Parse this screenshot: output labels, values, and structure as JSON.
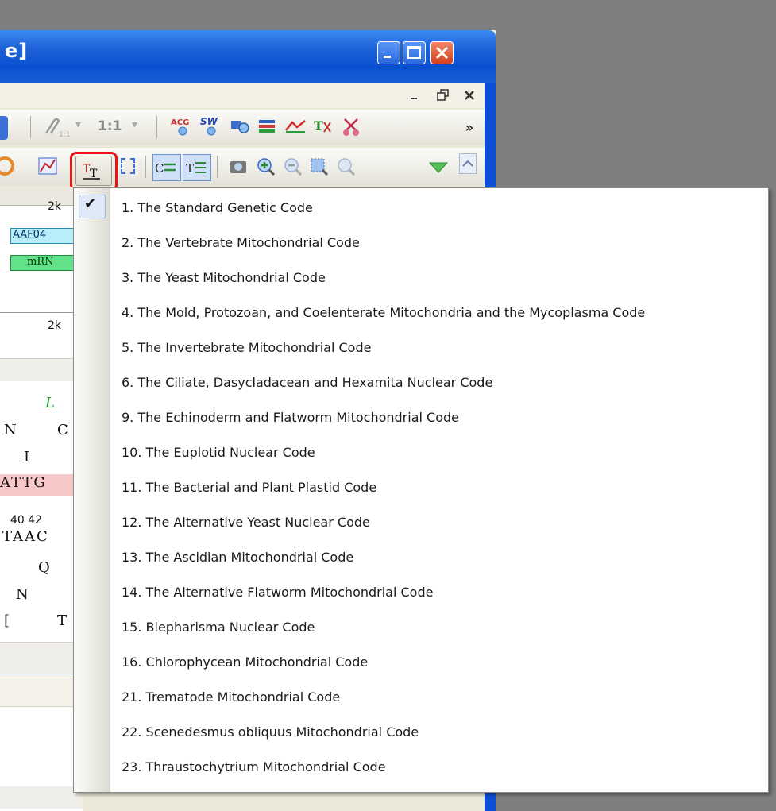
{
  "window": {
    "title_fragment": "e]",
    "caption_buttons": [
      "minimize-icon",
      "maximize-icon",
      "close-icon"
    ],
    "mdi_buttons": [
      "minimize-icon",
      "restore-icon",
      "close-icon"
    ],
    "accent_color": "#0c4fd6"
  },
  "toolbar1": {
    "zoom_label": "1:1",
    "overflow_label": "»",
    "icons": [
      "paperclip-icon",
      "acg-search-icon",
      "sw-search-icon",
      "find-icon",
      "list-icon",
      "map-icon",
      "tool-icon",
      "scissors-icon"
    ]
  },
  "toolbar2": {
    "icons": [
      "circle-map-icon",
      "chart-icon",
      "translate-icon",
      "select-icon",
      "sync-left-icon",
      "sync-right-icon",
      "camera-icon",
      "zoom-in-icon",
      "zoom-out-icon",
      "zoom-fit-icon",
      "zoom-reset-icon",
      "triangle-down-icon"
    ]
  },
  "sequence_view": {
    "ruler_top": "2k",
    "feature_1": "AAF04",
    "feature_2": "mRN",
    "ruler_bottom": "2k",
    "aa_top": "L",
    "row1_left": "N",
    "row1_right": "C",
    "row2": "I",
    "dna_top": "ATTG",
    "pos_labels": "40 42",
    "dna_bottom": "TAAC",
    "aa_q": "Q",
    "aa_n": "N",
    "aa_t_left": "[",
    "aa_t": "T"
  },
  "menu": {
    "selected_index": 0,
    "check_mark": "✔",
    "items": [
      "1. The Standard Genetic Code",
      "2. The Vertebrate Mitochondrial Code",
      "3. The Yeast Mitochondrial Code",
      "4. The Mold, Protozoan, and Coelenterate Mitochondria and the Mycoplasma Code",
      "5. The Invertebrate Mitochondrial Code",
      "6. The Ciliate, Dasycladacean and Hexamita Nuclear Code",
      "9. The Echinoderm and Flatworm Mitochondrial Code",
      "10. The Euplotid Nuclear Code",
      "11. The Bacterial and Plant Plastid Code",
      "12. The Alternative Yeast Nuclear Code",
      "13. The Ascidian Mitochondrial Code",
      "14. The Alternative Flatworm Mitochondrial Code",
      "15. Blepharisma Nuclear Code",
      "16. Chlorophycean Mitochondrial Code",
      "21. Trematode Mitochondrial Code",
      "22. Scenedesmus obliquus Mitochondrial Code",
      "23. Thraustochytrium Mitochondrial Code"
    ]
  }
}
